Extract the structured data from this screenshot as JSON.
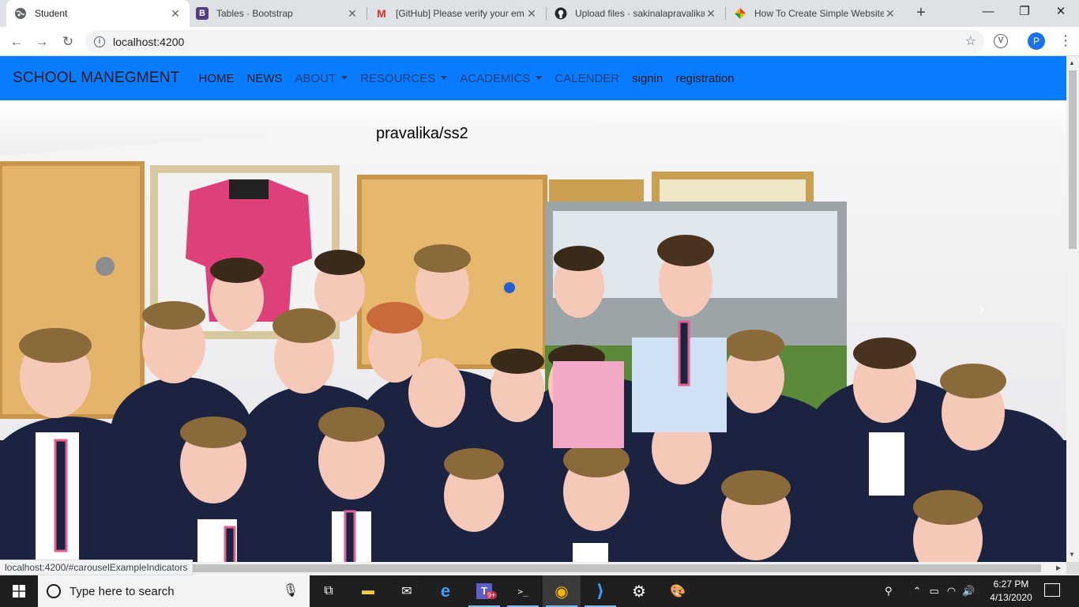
{
  "browser": {
    "tabs": [
      {
        "title": "Student",
        "favicon": "globe-icon",
        "active": true
      },
      {
        "title": "Tables · Bootstrap",
        "favicon": "bootstrap-icon",
        "active": false
      },
      {
        "title": "[GitHub] Please verify your em",
        "favicon": "gmail-icon",
        "active": false
      },
      {
        "title": "Upload files · sakinalapravalika",
        "favicon": "github-icon",
        "active": false
      },
      {
        "title": "How To Create Simple Website",
        "favicon": "colorful-icon",
        "active": false
      }
    ],
    "new_tab_symbol": "+",
    "window_controls": {
      "minimize": "—",
      "maximize": "❐",
      "close": "✕"
    },
    "address": "localhost:4200",
    "profile_initial": "P",
    "extension_letter": "V"
  },
  "page": {
    "navbar": {
      "brand": "SCHOOL MANEGMENT",
      "links": [
        {
          "label": "HOME",
          "dropdown": false,
          "tone": "dark"
        },
        {
          "label": "NEWS",
          "dropdown": false,
          "tone": "dark"
        },
        {
          "label": "ABOUT",
          "dropdown": true,
          "tone": "muted"
        },
        {
          "label": "RESOURCES",
          "dropdown": true,
          "tone": "muted"
        },
        {
          "label": "ACADEMICS",
          "dropdown": true,
          "tone": "muted"
        },
        {
          "label": "CALENDER",
          "dropdown": false,
          "tone": "muted"
        },
        {
          "label": "signin",
          "dropdown": false,
          "tone": "dark"
        },
        {
          "label": "registration",
          "dropdown": false,
          "tone": "dark"
        }
      ],
      "background": "#0a7cff"
    },
    "carousel": {
      "caption": "pravalika/ss2",
      "image": "group-photo-of-students-in-school-uniform",
      "next_symbol": "›"
    },
    "status_url": "localhost:4200/#carouselExampleIndicators"
  },
  "taskbar": {
    "search_placeholder": "Type here to search",
    "apps": [
      {
        "name": "task-view-icon",
        "glyph": "⧉"
      },
      {
        "name": "file-explorer-icon",
        "glyph": "▬"
      },
      {
        "name": "mail-icon",
        "glyph": "✉"
      },
      {
        "name": "edge-icon",
        "glyph": "e"
      },
      {
        "name": "teams-icon",
        "glyph": "T"
      },
      {
        "name": "terminal-icon",
        "glyph": ">_"
      },
      {
        "name": "chrome-icon",
        "glyph": "◉"
      },
      {
        "name": "vscode-icon",
        "glyph": "⟩"
      },
      {
        "name": "settings-icon",
        "glyph": "⚙"
      },
      {
        "name": "paint-icon",
        "glyph": "🎨"
      }
    ],
    "teams_badge": "9+",
    "time": "6:27 PM",
    "date": "4/13/2020"
  }
}
